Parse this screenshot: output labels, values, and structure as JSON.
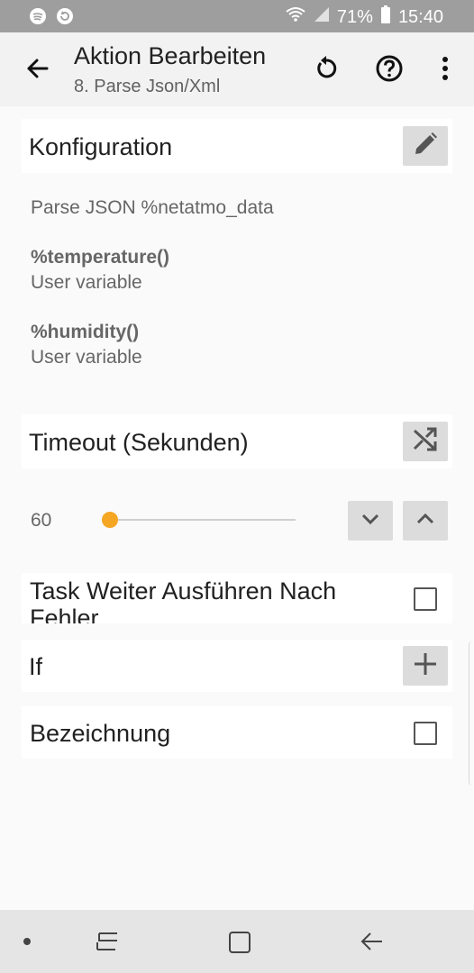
{
  "status_bar": {
    "battery_percent": "71%",
    "time": "15:40",
    "icons": [
      "spotify-icon",
      "sync-icon",
      "wifi-icon",
      "signal-icon",
      "battery-icon"
    ]
  },
  "app_bar": {
    "title": "Aktion Bearbeiten",
    "subtitle": "8. Parse Json/Xml",
    "icons": [
      "back-arrow-icon",
      "reset-icon",
      "help-icon",
      "overflow-menu-icon"
    ]
  },
  "config": {
    "header": "Konfiguration",
    "summary": "Parse JSON %netatmo_data",
    "variables": [
      {
        "name": "%temperature()",
        "type": "User variable"
      },
      {
        "name": "%humidity()",
        "type": "User variable"
      }
    ]
  },
  "timeout": {
    "header": "Timeout (Sekunden)",
    "value": "60",
    "slider_fraction": 0.0
  },
  "continue_after_error": {
    "label": "Task Weiter Ausführen Nach Fehler",
    "checked": false
  },
  "if_section": {
    "label": "If"
  },
  "label_section": {
    "label": "Bezeichnung",
    "checked": false
  },
  "nav_bar": {
    "icons": [
      "dot-icon",
      "recents-icon",
      "home-icon",
      "back-icon"
    ]
  },
  "colors": {
    "accent": "#f5a623",
    "status_bar": "#9e9e9e",
    "app_bar": "#f2f2f2",
    "button_bg": "#dcdcdc"
  }
}
